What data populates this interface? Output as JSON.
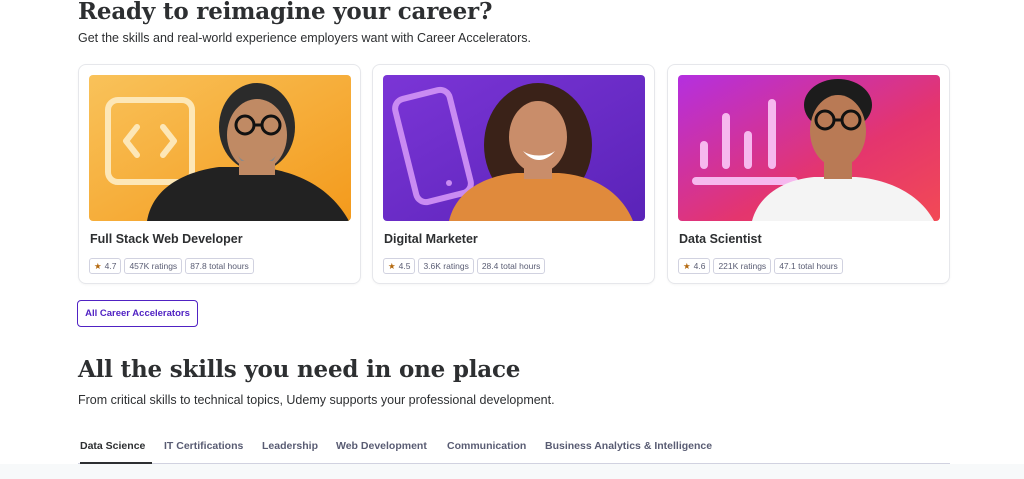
{
  "career": {
    "title": "Ready to reimagine your career?",
    "subtitle": "Get the skills and real-world experience employers want with Career Accelerators.",
    "cards": [
      {
        "name": "Full Stack Web Developer",
        "rating": "4.7",
        "ratings": "457K ratings",
        "hours": "87.8 total hours",
        "icon": "code-icon"
      },
      {
        "name": "Digital Marketer",
        "rating": "4.5",
        "ratings": "3.6K ratings",
        "hours": "28.4 total hours",
        "icon": "phone-icon"
      },
      {
        "name": "Data Scientist",
        "rating": "4.6",
        "ratings": "221K ratings",
        "hours": "47.1 total hours",
        "icon": "bar-chart-icon"
      }
    ],
    "all_button": "All Career Accelerators"
  },
  "skills": {
    "title": "All the skills you need in one place",
    "subtitle": "From critical skills to technical topics, Udemy supports your professional development.",
    "tabs": [
      "Data Science",
      "IT Certifications",
      "Leadership",
      "Web Development",
      "Communication",
      "Business Analytics & Intelligence"
    ],
    "active_tab": "Data Science"
  },
  "colors": {
    "brand_purple": "#5022c3",
    "star": "#b4690e",
    "card1_bg": "#f7a823",
    "card2_bg": "#6b2fc5",
    "card3_bg": "#c42fd6"
  }
}
